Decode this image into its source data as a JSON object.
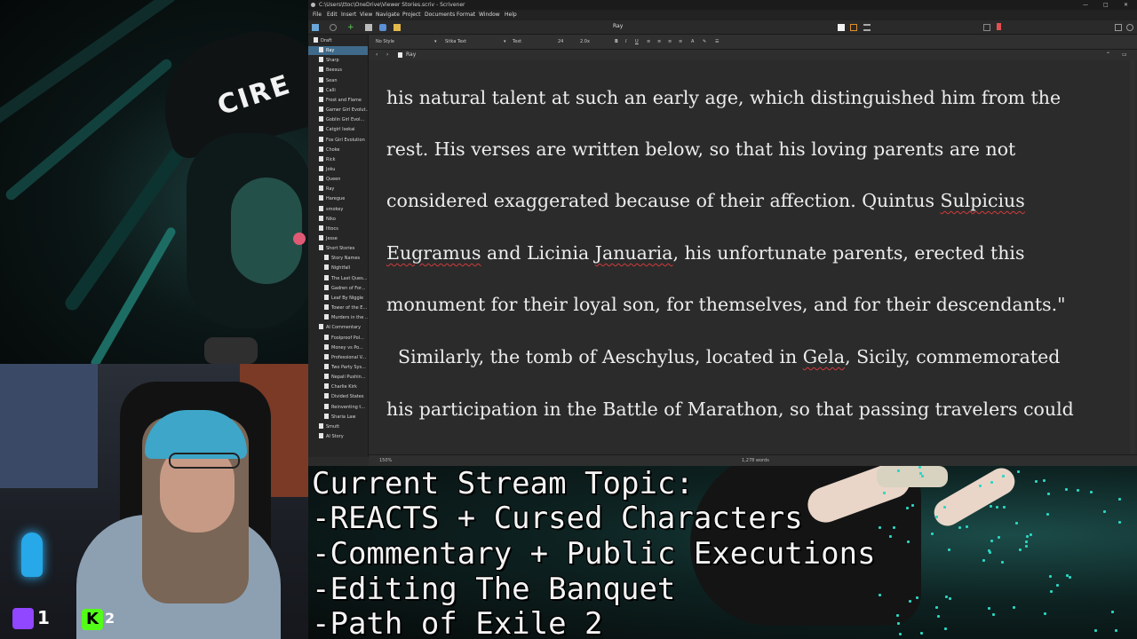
{
  "window": {
    "title": "C:\\Users\\ttoc\\OneDrive\\Viewer Stories.scriv - Scrivener",
    "controls": [
      "—",
      "□",
      "✕"
    ]
  },
  "menu": [
    "File",
    "Edit",
    "Insert",
    "View",
    "Navigate",
    "Project",
    "Documents",
    "Format",
    "Window",
    "Help"
  ],
  "toolbar": {
    "doc_title": "Ray"
  },
  "binder": [
    {
      "label": "Draft",
      "indent": 0,
      "selected": false
    },
    {
      "label": "Ray",
      "indent": 1,
      "selected": true
    },
    {
      "label": "Sharp",
      "indent": 1,
      "selected": false
    },
    {
      "label": "Beesus",
      "indent": 1,
      "selected": false
    },
    {
      "label": "Sean",
      "indent": 1,
      "selected": false
    },
    {
      "label": "Calli",
      "indent": 1,
      "selected": false
    },
    {
      "label": "Frost and Flame",
      "indent": 1,
      "selected": false
    },
    {
      "label": "Gamer Girl Evolut...",
      "indent": 1,
      "selected": false
    },
    {
      "label": "Goblin Girl Evol...",
      "indent": 1,
      "selected": false
    },
    {
      "label": "Catgirl Isekai",
      "indent": 1,
      "selected": false
    },
    {
      "label": "Fox Girl Evolution",
      "indent": 1,
      "selected": false
    },
    {
      "label": "Choke",
      "indent": 1,
      "selected": false
    },
    {
      "label": "Rick",
      "indent": 1,
      "selected": false
    },
    {
      "label": "Joku",
      "indent": 1,
      "selected": false
    },
    {
      "label": "Queen",
      "indent": 1,
      "selected": false
    },
    {
      "label": "Ray",
      "indent": 1,
      "selected": false
    },
    {
      "label": "Haregue",
      "indent": 1,
      "selected": false
    },
    {
      "label": "smokey",
      "indent": 1,
      "selected": false
    },
    {
      "label": "Niko",
      "indent": 1,
      "selected": false
    },
    {
      "label": "Ittocs",
      "indent": 1,
      "selected": false
    },
    {
      "label": "Jesse",
      "indent": 1,
      "selected": false
    },
    {
      "label": "Short Stories",
      "indent": 1,
      "selected": false
    },
    {
      "label": "Story Names",
      "indent": 2,
      "selected": false
    },
    {
      "label": "Nightfall",
      "indent": 2,
      "selected": false
    },
    {
      "label": "The Last Ques...",
      "indent": 2,
      "selected": false
    },
    {
      "label": "Gadren of For...",
      "indent": 2,
      "selected": false
    },
    {
      "label": "Leaf By Niggle",
      "indent": 2,
      "selected": false
    },
    {
      "label": "Tower of the E...",
      "indent": 2,
      "selected": false
    },
    {
      "label": "Murders in the ...",
      "indent": 2,
      "selected": false
    },
    {
      "label": "AI Commentary",
      "indent": 1,
      "selected": false
    },
    {
      "label": "Foolproof Pol...",
      "indent": 2,
      "selected": false
    },
    {
      "label": "Money vs Po...",
      "indent": 2,
      "selected": false
    },
    {
      "label": "Professional V...",
      "indent": 2,
      "selected": false
    },
    {
      "label": "Two Party Sys...",
      "indent": 2,
      "selected": false
    },
    {
      "label": "Nepali Pushin...",
      "indent": 2,
      "selected": false
    },
    {
      "label": "Charlie Kirk",
      "indent": 2,
      "selected": false
    },
    {
      "label": "Divided States",
      "indent": 2,
      "selected": false
    },
    {
      "label": "Reinventing t...",
      "indent": 2,
      "selected": false
    },
    {
      "label": "Sharia Law",
      "indent": 2,
      "selected": false
    },
    {
      "label": "Smutt",
      "indent": 1,
      "selected": false
    },
    {
      "label": "AI Story",
      "indent": 1,
      "selected": false
    }
  ],
  "format": {
    "style": "No Style",
    "font": "Sitka Text",
    "face": "Text",
    "size": "24",
    "spacing": "2.0x"
  },
  "header": {
    "doc_name": "Ray"
  },
  "editor": {
    "lines": [
      "his natural talent at such an early age, which distinguished him from the",
      "rest. His verses are written below, so that his loving parents are not",
      "considered exaggerated because of their affection. Quintus Sulpicius",
      "Eugramus and Licinia Januaria, his unfortunate parents, erected this",
      "monument for their loyal son, for themselves, and for their descendants.\"",
      "  Similarly, the tomb of Aeschylus, located in Gela, Sicily, commemorated",
      "his participation in the Battle of Marathon, so that passing travelers could"
    ]
  },
  "footer": {
    "zoom": "150%",
    "words": "1,278 words"
  },
  "stream_topic": [
    "Current Stream Topic:",
    "-REACTS + Cursed Characters",
    "-Commentary + Public Executions",
    "-Editing The Banquet",
    "-Path of Exile 2"
  ],
  "overlay": {
    "cap_text": "CIRE",
    "twitch_count": "1",
    "kick_count": "2"
  },
  "colors": {
    "twitch": "#9146ff",
    "kick": "#53fc18",
    "selection": "#3f6a8a",
    "editor_bg": "#2b2b2b"
  }
}
